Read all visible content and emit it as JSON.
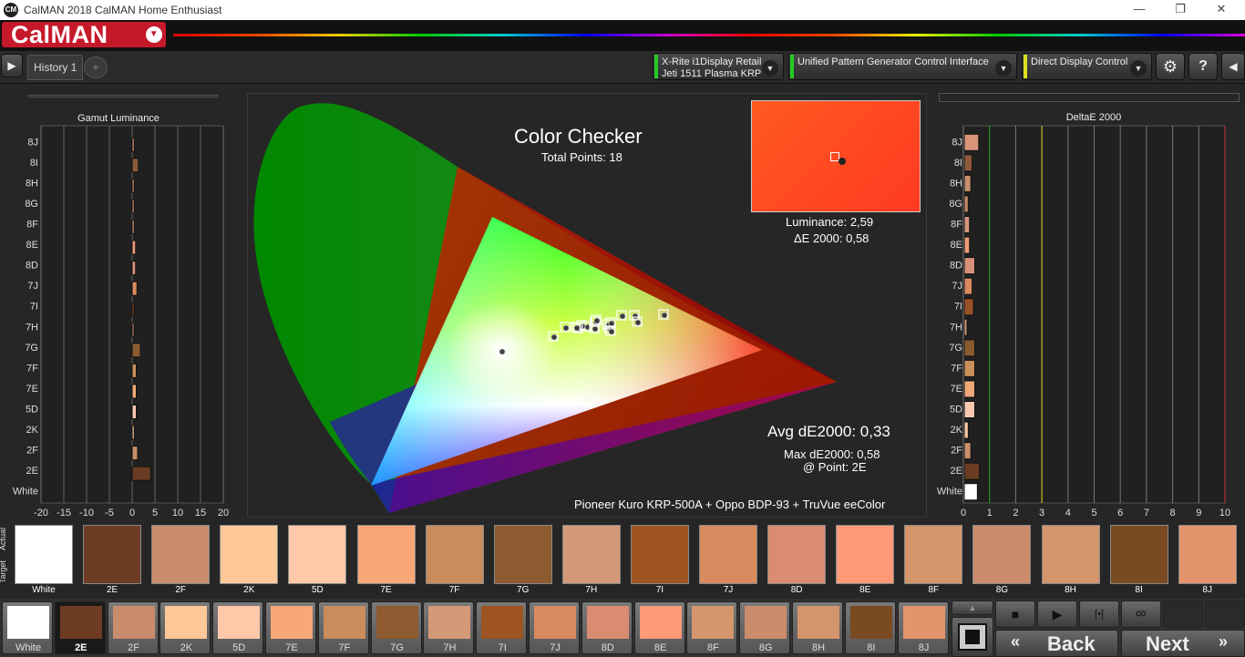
{
  "window": {
    "title": "CalMAN 2018 CalMAN Home Enthusiast",
    "logo_text": "CM",
    "minimize": "—",
    "maximize": "❐",
    "close": "✕"
  },
  "app": {
    "brand": "CalMAN",
    "brand_caret": "▼"
  },
  "toolbar": {
    "play_icon": "▶",
    "history_tab": "History 1",
    "add_tab": "+",
    "meter": {
      "line1": "X-Rite i1Display Retail",
      "line2": "Jeti 1511 Plasma KRP",
      "color": "#22cc22"
    },
    "pattern_gen": {
      "line1": "Unified Pattern Generator Control Interface",
      "color": "#22cc22"
    },
    "display": {
      "line1": "Direct Display Control",
      "color": "#dddd22"
    },
    "caret": "▼",
    "settings_icon": "⚙",
    "help_icon": "?",
    "back_icon": "◀"
  },
  "gamut_luminance": {
    "title": "Gamut Luminance",
    "rows": [
      "8J",
      "8I",
      "8H",
      "8G",
      "8F",
      "8E",
      "8D",
      "7J",
      "7I",
      "7H",
      "7G",
      "7F",
      "7E",
      "5D",
      "2K",
      "2F",
      "2E",
      "White"
    ],
    "values": [
      0.3,
      0.9,
      0.3,
      0.3,
      0.3,
      0.5,
      0.5,
      0.7,
      0.1,
      0.1,
      1.2,
      0.6,
      0.6,
      0.6,
      0.3,
      0.8,
      2.7,
      0
    ],
    "x_ticks": [
      "-20",
      "-15",
      "-10",
      "-5",
      "0",
      "5",
      "10",
      "15",
      "20"
    ]
  },
  "cie": {
    "title": "Color Checker",
    "subtitle": "Total Points: 18",
    "luminance": "Luminance: 2,59",
    "delta_e": "ΔE 2000: 0,58",
    "avg": "Avg dE2000: 0,33",
    "max": "Max dE2000: 0,58",
    "point": "@ Point: 2E",
    "setup": "Pioneer Kuro KRP-500A + Oppo BDP-93 + TruVue eeColor",
    "preview_color": "#ff4a22"
  },
  "delta_e": {
    "title": "DeltaE 2000",
    "rows": [
      "8J",
      "8I",
      "8H",
      "8G",
      "8F",
      "8E",
      "8D",
      "7J",
      "7I",
      "7H",
      "7G",
      "7F",
      "7E",
      "5D",
      "2K",
      "2F",
      "2E",
      "White"
    ],
    "values": [
      0.55,
      0.3,
      0.25,
      0.15,
      0.2,
      0.2,
      0.4,
      0.3,
      0.35,
      0.1,
      0.4,
      0.4,
      0.4,
      0.4,
      0.15,
      0.25,
      0.58,
      0.5
    ],
    "colors": [
      "#d9957a",
      "#8c5a3a",
      "#c8906a",
      "#c48a6a",
      "#d4957a",
      "#f09a7a",
      "#d8907a",
      "#d98a60",
      "#9a5028",
      "#d49a7a",
      "#8a5a30",
      "#c8905a",
      "#f0a878",
      "#f8c8b0",
      "#f8c8a0",
      "#c8906a",
      "#6a3c24",
      "#ffffff"
    ],
    "x_ticks": [
      "0",
      "1",
      "2",
      "3",
      "4",
      "5",
      "6",
      "7",
      "8",
      "9",
      "10"
    ]
  },
  "swatches": {
    "side_labels": [
      "Actual",
      "Target"
    ],
    "big": [
      {
        "label": "White",
        "color": "#ffffff"
      },
      {
        "label": "2E",
        "color": "#6e3c22"
      },
      {
        "label": "2F",
        "color": "#c98c6c"
      },
      {
        "label": "2K",
        "color": "#ffc898"
      },
      {
        "label": "5D",
        "color": "#ffc8a8"
      },
      {
        "label": "7E",
        "color": "#f8a878"
      },
      {
        "label": "7F",
        "color": "#c98c5c"
      },
      {
        "label": "7G",
        "color": "#8e5a30"
      },
      {
        "label": "7H",
        "color": "#d49a78"
      },
      {
        "label": "7I",
        "color": "#9e5420"
      },
      {
        "label": "7J",
        "color": "#d98a5e"
      },
      {
        "label": "8D",
        "color": "#d98c70"
      },
      {
        "label": "8E",
        "color": "#ff9a78"
      },
      {
        "label": "8F",
        "color": "#d4966a"
      },
      {
        "label": "8G",
        "color": "#cc8c6c"
      },
      {
        "label": "8H",
        "color": "#d4946c"
      },
      {
        "label": "8I",
        "color": "#7a4a22"
      },
      {
        "label": "8J",
        "color": "#e4946c"
      }
    ],
    "small": [
      {
        "label": "White",
        "color": "#ffffff"
      },
      {
        "label": "2E",
        "color": "#6e3c22"
      },
      {
        "label": "2F",
        "color": "#c98c6c"
      },
      {
        "label": "2K",
        "color": "#ffc898"
      },
      {
        "label": "5D",
        "color": "#ffc8a8"
      },
      {
        "label": "7E",
        "color": "#f8a878"
      },
      {
        "label": "7F",
        "color": "#c98c5c"
      },
      {
        "label": "7G",
        "color": "#8e5a30"
      },
      {
        "label": "7H",
        "color": "#d49a78"
      },
      {
        "label": "7I",
        "color": "#9e5420"
      },
      {
        "label": "7J",
        "color": "#d98a5e"
      },
      {
        "label": "8D",
        "color": "#d98c70"
      },
      {
        "label": "8E",
        "color": "#ff9a78"
      },
      {
        "label": "8F",
        "color": "#d4966a"
      },
      {
        "label": "8G",
        "color": "#cc8c6c"
      },
      {
        "label": "8H",
        "color": "#d4946c"
      },
      {
        "label": "8I",
        "color": "#7a4a22"
      },
      {
        "label": "8J",
        "color": "#e4946c"
      }
    ],
    "selected": "2E"
  },
  "controls": {
    "up_icon": "▲",
    "stop_icon": "■",
    "play_icon": "▶",
    "step_icon": "[•]",
    "loop_icon": "∞",
    "back_label": "Back",
    "back_icon": "«",
    "next_label": "Next",
    "next_icon": "»"
  }
}
